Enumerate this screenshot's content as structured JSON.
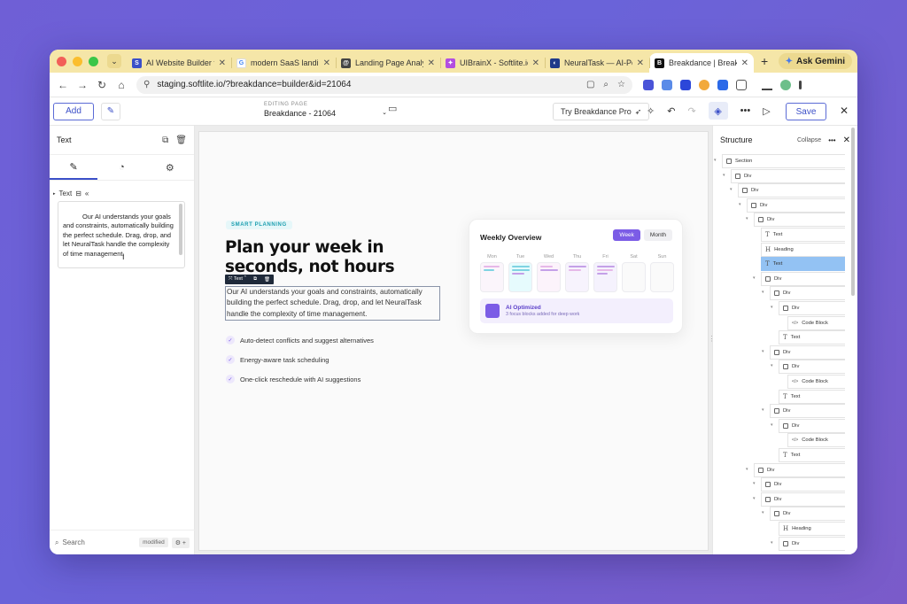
{
  "browser": {
    "tabs": [
      {
        "title": "AI Website Builder fo",
        "fav": "S",
        "color": "#3b4fc8",
        "active": false
      },
      {
        "title": "modern SaaS landing",
        "fav": "G",
        "color": "#ffffff",
        "active": false
      },
      {
        "title": "Landing Page Analy",
        "fav": "@",
        "color": "#444444",
        "active": false
      },
      {
        "title": "UIBrainX - Softlite.io",
        "fav": "✦",
        "color": "#b24ee0",
        "active": false
      },
      {
        "title": "NeuralTask — AI-Po",
        "fav": "◐",
        "color": "#1f3a8a",
        "active": false
      },
      {
        "title": "Breakdance | Breakd",
        "fav": "B",
        "color": "#111111",
        "active": true
      }
    ],
    "gemini_label": "Ask Gemini",
    "url": "staging.softlite.io/?breakdance=builder&id=21064"
  },
  "toolbar": {
    "add_label": "Add",
    "editing_label": "EDITING PAGE",
    "page_name": "Breakdance - 21064",
    "try_label": "Try Breakdance Pro",
    "save_label": "Save"
  },
  "left_panel": {
    "title": "Text",
    "field_label": "Text",
    "text_value": "Our AI understands your goals and constraints, automatically building the perfect schedule. Drag, drop, and let NeuralTask handle the complexity of time management.",
    "search_placeholder": "Search",
    "modified_label": "modified"
  },
  "canvas": {
    "badge": "SMART PLANNING",
    "heading": "Plan your week in seconds, not hours",
    "selection_label": "Text",
    "paragraph": "Our AI understands your goals and constraints, automatically building the perfect schedule. Drag, drop, and let NeuralTask handle the complexity of time management.",
    "features": [
      "Auto-detect conflicts and suggest alternatives",
      "Energy-aware task scheduling",
      "One-click reschedule with AI suggestions"
    ],
    "card": {
      "title": "Weekly Overview",
      "week_label": "Week",
      "month_label": "Month",
      "days": [
        "Mon",
        "Tue",
        "Wed",
        "Thu",
        "Fri",
        "Sat",
        "Sun"
      ],
      "ai_title": "AI Optimized",
      "ai_sub": "3 focus blocks added for deep work"
    }
  },
  "structure": {
    "title": "Structure",
    "collapse_label": "Collapse",
    "nodes": [
      {
        "label": "Section",
        "type": "box",
        "depth": 0
      },
      {
        "label": "Div",
        "type": "box",
        "depth": 1
      },
      {
        "label": "Div",
        "type": "box",
        "depth": 2
      },
      {
        "label": "Div",
        "type": "box",
        "depth": 3
      },
      {
        "label": "Div",
        "type": "box",
        "depth": 4
      },
      {
        "label": "Text",
        "type": "text",
        "depth": 5
      },
      {
        "label": "Heading",
        "type": "heading",
        "depth": 5
      },
      {
        "label": "Text",
        "type": "text",
        "depth": 5,
        "selected": true
      },
      {
        "label": "Div",
        "type": "box",
        "depth": 5
      },
      {
        "label": "Div",
        "type": "box",
        "depth": 6
      },
      {
        "label": "Div",
        "type": "box",
        "depth": 7
      },
      {
        "label": "Code Block",
        "type": "code",
        "depth": 8
      },
      {
        "label": "Text",
        "type": "text",
        "depth": 7
      },
      {
        "label": "Div",
        "type": "box",
        "depth": 6
      },
      {
        "label": "Div",
        "type": "box",
        "depth": 7
      },
      {
        "label": "Code Block",
        "type": "code",
        "depth": 8
      },
      {
        "label": "Text",
        "type": "text",
        "depth": 7
      },
      {
        "label": "Div",
        "type": "box",
        "depth": 6
      },
      {
        "label": "Div",
        "type": "box",
        "depth": 7
      },
      {
        "label": "Code Block",
        "type": "code",
        "depth": 8
      },
      {
        "label": "Text",
        "type": "text",
        "depth": 7
      },
      {
        "label": "Div",
        "type": "box",
        "depth": 4
      },
      {
        "label": "Div",
        "type": "box",
        "depth": 5
      },
      {
        "label": "Div",
        "type": "box",
        "depth": 5
      },
      {
        "label": "Div",
        "type": "box",
        "depth": 6
      },
      {
        "label": "Heading",
        "type": "heading",
        "depth": 7
      },
      {
        "label": "Div",
        "type": "box",
        "depth": 7
      }
    ]
  },
  "colors": {
    "accent": "#7b5ce6",
    "builder_blue": "#3b4fc8",
    "selected_node": "#93c2f3",
    "tab_bar": "#f5e6a8"
  }
}
